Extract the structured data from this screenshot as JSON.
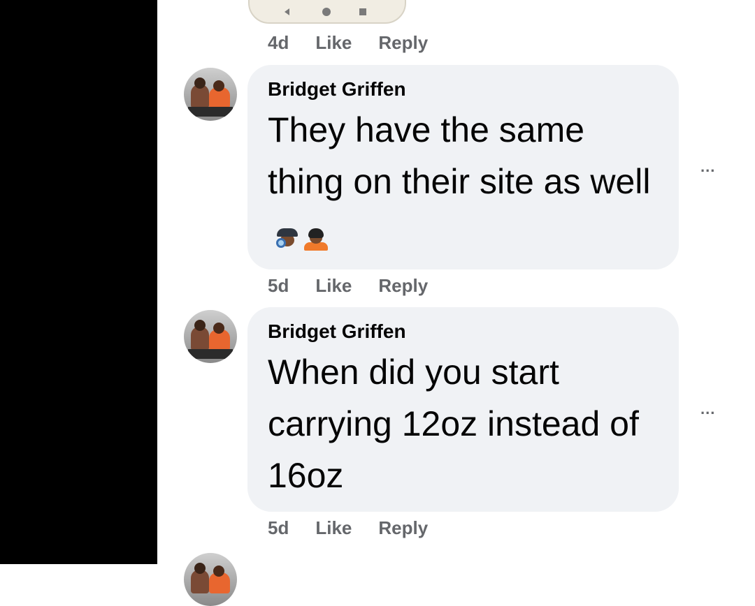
{
  "top_meta": {
    "time": "4d",
    "like": "Like",
    "reply": "Reply"
  },
  "comments": [
    {
      "author": "Bridget Griffen",
      "text": "They have the same thing on their site as well",
      "emojis": [
        "detective-emoji",
        "person-shrugging-emoji"
      ],
      "time": "5d",
      "like": "Like",
      "reply": "Reply",
      "more": "..."
    },
    {
      "author": "Bridget Griffen",
      "text": "When did you start carrying 12oz instead of 16oz",
      "time": "5d",
      "like": "Like",
      "reply": "Reply",
      "more": "..."
    }
  ],
  "colors": {
    "bubble": "#f0f2f5",
    "meta": "#65676b",
    "text": "#050505",
    "side": "#000000"
  }
}
